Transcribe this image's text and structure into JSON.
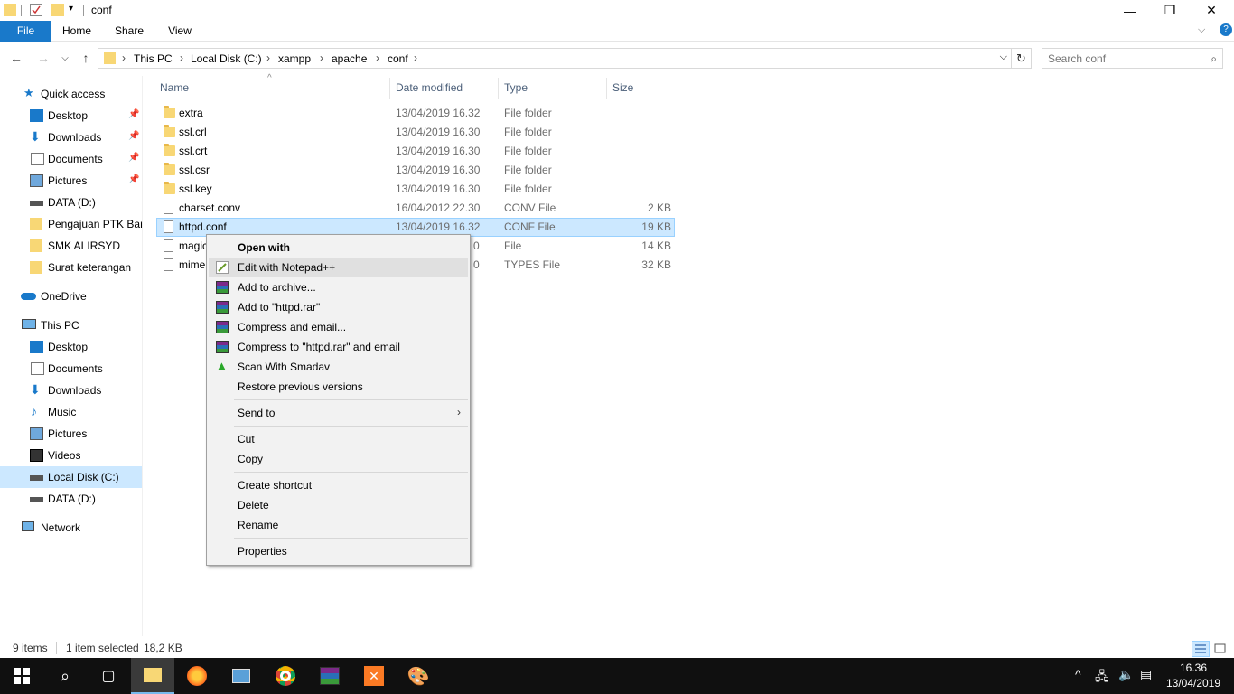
{
  "window": {
    "title": "conf",
    "controls": [
      "minimize-icon",
      "restore-icon",
      "close-icon"
    ]
  },
  "ribbon": {
    "tabs": [
      "File",
      "Home",
      "Share",
      "View"
    ]
  },
  "address": {
    "breadcrumbs": [
      "This PC",
      "Local Disk (C:)",
      "xampp",
      "apache",
      "conf"
    ]
  },
  "search": {
    "placeholder": "Search conf"
  },
  "sidebar": {
    "quick_access": "Quick access",
    "quick_items": [
      "Desktop",
      "Downloads",
      "Documents",
      "Pictures",
      "DATA (D:)",
      "Pengajuan PTK Baru",
      "SMK ALIRSYD",
      "Surat keterangan"
    ],
    "onedrive": "OneDrive",
    "this_pc": "This PC",
    "pc_items": [
      "Desktop",
      "Documents",
      "Downloads",
      "Music",
      "Pictures",
      "Videos",
      "Local Disk (C:)",
      "DATA (D:)"
    ],
    "network": "Network"
  },
  "columns": {
    "name": "Name",
    "date": "Date modified",
    "type": "Type",
    "size": "Size"
  },
  "files": [
    {
      "name": "extra",
      "date": "13/04/2019 16.32",
      "type": "File folder",
      "size": ""
    },
    {
      "name": "ssl.crl",
      "date": "13/04/2019 16.30",
      "type": "File folder",
      "size": ""
    },
    {
      "name": "ssl.crt",
      "date": "13/04/2019 16.30",
      "type": "File folder",
      "size": ""
    },
    {
      "name": "ssl.csr",
      "date": "13/04/2019 16.30",
      "type": "File folder",
      "size": ""
    },
    {
      "name": "ssl.key",
      "date": "13/04/2019 16.30",
      "type": "File folder",
      "size": ""
    },
    {
      "name": "charset.conv",
      "date": "16/04/2012 22.30",
      "type": "CONV File",
      "size": "2 KB"
    },
    {
      "name": "httpd.conf",
      "date": "13/04/2019 16.32",
      "type": "CONF File",
      "size": "19 KB"
    },
    {
      "name": "magic",
      "date": "0",
      "type": "File",
      "size": "14 KB"
    },
    {
      "name": "mime",
      "date": "0",
      "type": "TYPES File",
      "size": "32 KB"
    }
  ],
  "context_menu": {
    "open_with": "Open with",
    "edit_notepad": "Edit with Notepad++",
    "add_archive": "Add to archive...",
    "add_rar": "Add to \"httpd.rar\"",
    "compress_email": "Compress and email...",
    "compress_rar_email": "Compress to \"httpd.rar\" and email",
    "scan_smadav": "Scan With Smadav",
    "restore": "Restore previous versions",
    "send_to": "Send to",
    "cut": "Cut",
    "copy": "Copy",
    "create_shortcut": "Create shortcut",
    "delete": "Delete",
    "rename": "Rename",
    "properties": "Properties"
  },
  "status": {
    "items": "9 items",
    "selected": "1 item selected",
    "size": "18,2 KB"
  },
  "taskbar": {
    "time": "16.36",
    "date": "13/04/2019"
  },
  "colors": {
    "accent": "#1979ca",
    "selection": "#cce8ff",
    "folder": "#f8d775"
  }
}
